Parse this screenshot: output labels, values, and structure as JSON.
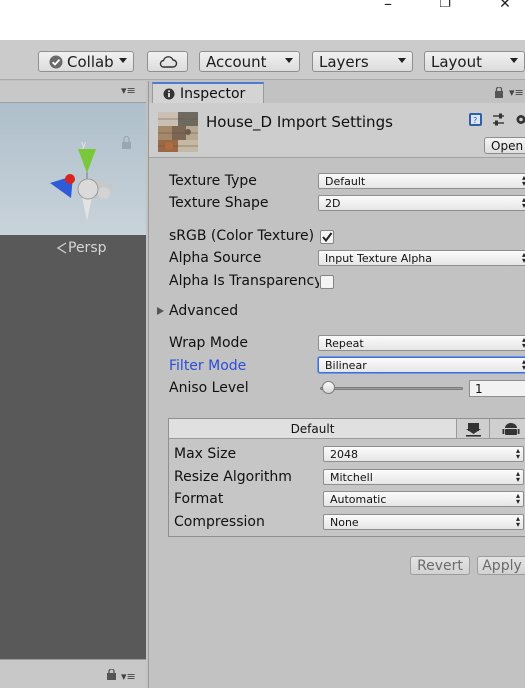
{
  "window": {
    "minimize_glyph": "–",
    "maximize_glyph": "❐",
    "close_glyph": "✕"
  },
  "toolbar": {
    "collab_label": "Collab",
    "account_label": "Account",
    "layers_label": "Layers",
    "layout_label": "Layout"
  },
  "scene": {
    "projection_label": "Persp",
    "menu_glyph": "▾≡",
    "lock_glyph": "🔒"
  },
  "inspector": {
    "tab_label": "Inspector",
    "asset_title": "House_D Import Settings",
    "open_label": "Open",
    "fields": {
      "texture_type": {
        "label": "Texture Type",
        "value": "Default"
      },
      "texture_shape": {
        "label": "Texture Shape",
        "value": "2D"
      },
      "srgb": {
        "label": "sRGB (Color Texture)",
        "checked": true
      },
      "alpha_source": {
        "label": "Alpha Source",
        "value": "Input Texture Alpha"
      },
      "alpha_transparency": {
        "label": "Alpha Is Transparency",
        "checked": false
      },
      "advanced": {
        "label": "Advanced"
      },
      "wrap_mode": {
        "label": "Wrap Mode",
        "value": "Repeat"
      },
      "filter_mode": {
        "label": "Filter Mode",
        "value": "Bilinear"
      },
      "aniso_level": {
        "label": "Aniso Level",
        "value": "1",
        "slider_fraction": 0.0
      }
    },
    "platform": {
      "tab_label": "Default",
      "max_size": {
        "label": "Max Size",
        "value": "2048"
      },
      "resize_algorithm": {
        "label": "Resize Algorithm",
        "value": "Mitchell"
      },
      "format": {
        "label": "Format",
        "value": "Automatic"
      },
      "compression": {
        "label": "Compression",
        "value": "None"
      }
    },
    "revert_label": "Revert",
    "apply_label": "Apply"
  },
  "colors": {
    "accent": "#4c7dd1",
    "focus_label": "#2a4ed9",
    "scene_ground": "#595959",
    "scene_sky": "#b2c6d3"
  }
}
